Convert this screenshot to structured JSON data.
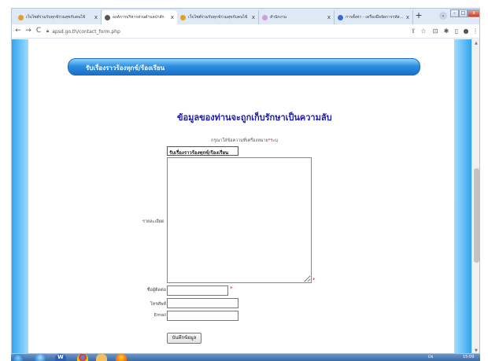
{
  "browser": {
    "tabs": [
      {
        "title": "เว็บไซต์ร่วมรับทุกข์ร่วมสุขกับคนไข้",
        "active": false
      },
      {
        "title": "องค์การบริหารส่วนตำบลป่าสัก",
        "active": true
      },
      {
        "title": "เว็บไซต์ร่วมรับทุกข์ร่วมสุขกับคนไข้",
        "active": false
      },
      {
        "title": "สำนักงาน",
        "active": false
      },
      {
        "title": "การตั้งค่า - เครื่องมือจัดการรหัสผ่าน",
        "active": false
      }
    ],
    "tab_close_glyph": "x",
    "new_tab_glyph": "+",
    "tab_list_glyph": "⌄",
    "window_controls": {
      "minimize": "–",
      "maximize": "□",
      "close": "x"
    },
    "nav": {
      "back": "←",
      "forward": "→",
      "reload": "C"
    },
    "url": "apsd.go.th/contact_form.php",
    "toolbar_icons": {
      "share": "⇪",
      "star": "☆",
      "extension": "⊡",
      "puzzle": "✱",
      "sidebar": "▯",
      "profile": "●",
      "menu": "⋮"
    }
  },
  "page": {
    "banner_title": "รับเรื่องราวร้องทุกข์/ร้องเรียน",
    "heading": "ข้อมูลของท่านจะถูกเก็บรักษาเป็นความลับ",
    "note_text": "กรุณาใส่ข้อความที่เครื่องหมาย",
    "note_star": "*",
    "note_suffix": "ระบุ",
    "subject_value": "รับเรื่องราวร้องทุกข์/ร้องเรียน",
    "detail_label": "รายละเอียด",
    "required_star": "*",
    "name_label": "ชื่อผู้ติดต่อ",
    "phone_label": "โทรศัพท์",
    "email_label": "Email",
    "submit_label": "บันทึกข้อมูล"
  },
  "taskbar": {
    "tray_text": "EN",
    "clock": "15:09"
  },
  "colors": {
    "banner": "#2d8fe0",
    "heading": "#1a1aa8",
    "required": "#e01010",
    "side_gradient": "#33a4f0"
  }
}
